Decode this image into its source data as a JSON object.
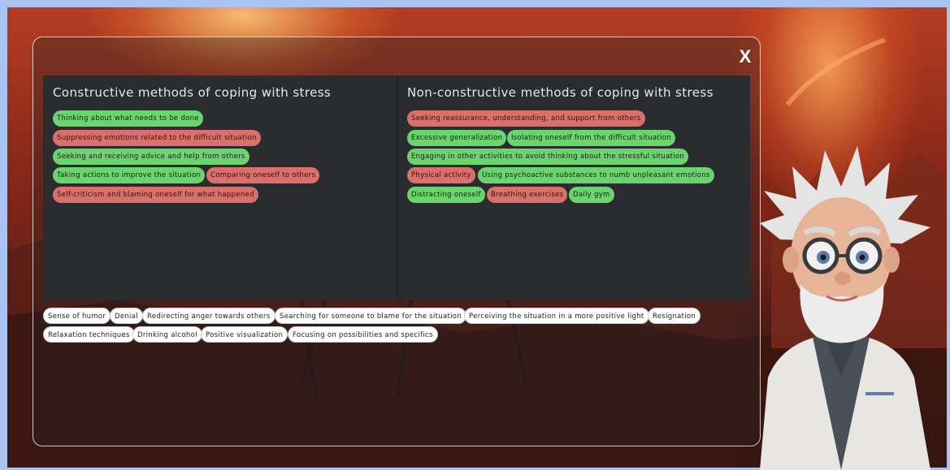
{
  "close_label": "X",
  "left_column": {
    "title": "Constructive methods of coping with stress",
    "items": [
      {
        "label": "Thinking about what needs to be done",
        "status": "correct"
      },
      {
        "label": "Suppressing emotions related to the difficult situation",
        "status": "incorrect"
      },
      {
        "label": "Seeking and receiving advice and help from others",
        "status": "correct"
      },
      {
        "label": "Taking actions to improve the situation",
        "status": "correct"
      },
      {
        "label": "Comparing oneself to others",
        "status": "incorrect"
      },
      {
        "label": "Self-criticism and blaming oneself for what happened",
        "status": "incorrect"
      }
    ]
  },
  "right_column": {
    "title": "Non-constructive methods of coping with stress",
    "items": [
      {
        "label": "Seeking reassurance, understanding, and support from others",
        "status": "incorrect"
      },
      {
        "label": "Excessive generalization",
        "status": "correct"
      },
      {
        "label": "Isolating oneself from the difficult situation",
        "status": "correct"
      },
      {
        "label": "Engaging in other activities to avoid thinking about the stressful situation",
        "status": "correct"
      },
      {
        "label": "Physical activity",
        "status": "incorrect"
      },
      {
        "label": "Using psychoactive substances to numb unpleasant emotions",
        "status": "correct"
      },
      {
        "label": "Distracting oneself",
        "status": "correct"
      },
      {
        "label": "Breathing exercises",
        "status": "incorrect"
      },
      {
        "label": "Daily gym",
        "status": "correct"
      }
    ]
  },
  "pool": {
    "items": [
      "Sense of humor",
      "Denial",
      "Redirecting anger towards others",
      "Searching for someone to blame for the situation",
      "Perceiving the situation in a more positive light",
      "Resignation",
      "Relaxation techniques",
      "Drinking alcohol",
      "Positive visualization",
      "Focusing on possibilities and specifics"
    ]
  },
  "colors": {
    "correct": "#6cd46e",
    "incorrect": "#d9706c",
    "pool": "#ffffff",
    "board": "#2b2c30",
    "frame": "#a9c4f2"
  }
}
